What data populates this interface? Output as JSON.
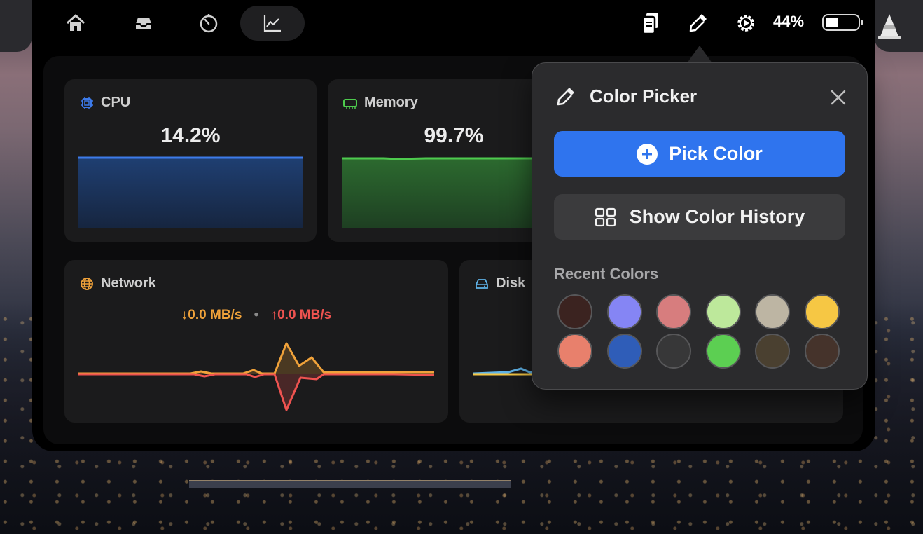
{
  "topbar": {
    "nav": [
      {
        "name": "home-icon",
        "active": false
      },
      {
        "name": "inbox-tray-icon",
        "active": false
      },
      {
        "name": "timer-icon",
        "active": false
      },
      {
        "name": "stats-chart-icon",
        "active": true
      }
    ],
    "status_icons": [
      "clipboard-icon",
      "eyedropper-icon",
      "gear-play-icon"
    ],
    "battery_percent": "44%",
    "battery_level": 0.44
  },
  "cards": {
    "cpu": {
      "title": "CPU",
      "value": "14.2%",
      "color": "#3d7bea",
      "fill": "#1e3a66"
    },
    "memory": {
      "title": "Memory",
      "value": "99.7%",
      "color": "#4ecb4e",
      "fill": "#25562a"
    },
    "network": {
      "title": "Network",
      "download": "↓0.0 MB/s",
      "separator": "•",
      "upload": "↑0.0 MB/s",
      "download_color": "#f0a23a",
      "upload_color": "#ef5350"
    },
    "disk": {
      "title": "Disk"
    }
  },
  "color_picker": {
    "title": "Color Picker",
    "pick_label": "Pick Color",
    "history_label": "Show Color History",
    "recent_label": "Recent Colors",
    "recent_colors": [
      "#3b2320",
      "#8585f4",
      "#d77d7e",
      "#bde89b",
      "#bdb5a3",
      "#f6c744",
      "#e8806c",
      "#2f5db8",
      "#373738",
      "#5ccf52",
      "#4a4030",
      "#45332b"
    ],
    "accent": "#2f74ee"
  }
}
